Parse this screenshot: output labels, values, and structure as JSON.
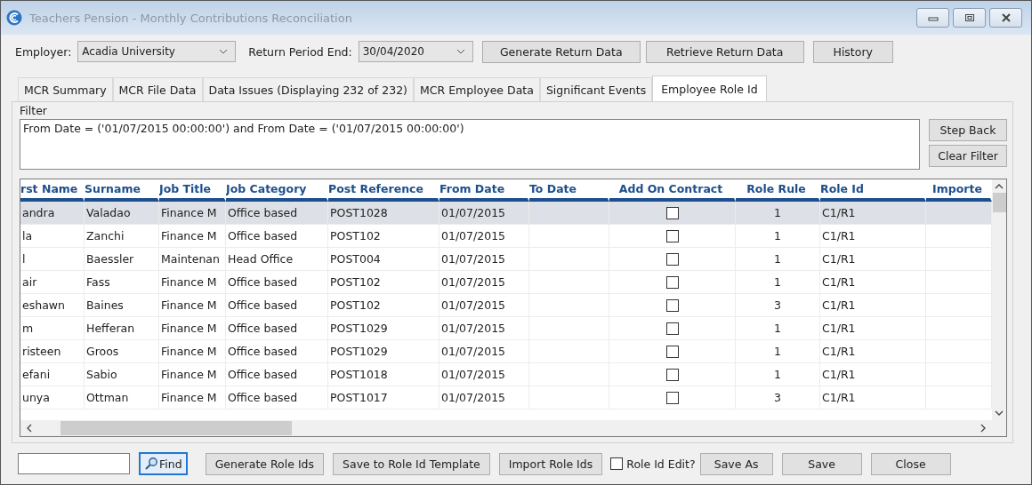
{
  "window": {
    "title": "Teachers Pension - Monthly Contributions Reconciliation"
  },
  "toolbar": {
    "employer_label": "Employer:",
    "employer_value": "Acadia University",
    "period_label": "Return Period End:",
    "period_value": "30/04/2020",
    "buttons": [
      "Generate Return Data",
      "Retrieve Return Data",
      "History"
    ]
  },
  "tabs": [
    {
      "label": "MCR Summary",
      "selected": false
    },
    {
      "label": "MCR File Data",
      "selected": false
    },
    {
      "label": "Data Issues (Displaying 232 of 232)",
      "selected": false
    },
    {
      "label": "MCR Employee Data",
      "selected": false
    },
    {
      "label": "Significant Events",
      "selected": false
    },
    {
      "label": "Employee Role Id",
      "selected": true
    }
  ],
  "filter": {
    "label": "Filter",
    "value": "From Date = ('01/07/2015 00:00:00') and From Date = ('01/07/2015 00:00:00')",
    "buttons": [
      "Step Back",
      "Clear Filter"
    ]
  },
  "table": {
    "columns": [
      "rst Name",
      "Surname",
      "Job Title",
      "Job Category",
      "Post Reference",
      "From Date",
      "To Date",
      "Add On Contract",
      "Role Rule",
      "Role Id",
      "Importe"
    ],
    "rows": [
      {
        "selected": true,
        "first_name": "andra",
        "surname": "Valadao",
        "job_title": "Finance M",
        "job_category": "Office based",
        "post_reference": "POST1028",
        "from_date": "01/07/2015",
        "add_on_contract": false,
        "role_rule": "1",
        "role_id": "C1/R1"
      },
      {
        "selected": false,
        "first_name": "la",
        "surname": "Zanchi",
        "job_title": "Finance M",
        "job_category": "Office based",
        "post_reference": "POST102",
        "from_date": "01/07/2015",
        "add_on_contract": false,
        "role_rule": "1",
        "role_id": "C1/R1"
      },
      {
        "selected": false,
        "first_name": "l",
        "surname": "Baessler",
        "job_title": "Maintenan",
        "job_category": "Head Office",
        "post_reference": "POST004",
        "from_date": "01/07/2015",
        "add_on_contract": false,
        "role_rule": "1",
        "role_id": "C1/R1"
      },
      {
        "selected": false,
        "first_name": "air",
        "surname": "Fass",
        "job_title": "Finance M",
        "job_category": "Office based",
        "post_reference": "POST102",
        "from_date": "01/07/2015",
        "add_on_contract": false,
        "role_rule": "1",
        "role_id": "C1/R1"
      },
      {
        "selected": false,
        "first_name": "eshawn",
        "surname": "Baines",
        "job_title": "Finance M",
        "job_category": "Office based",
        "post_reference": "POST102",
        "from_date": "01/07/2015",
        "add_on_contract": false,
        "role_rule": "3",
        "role_id": "C1/R1"
      },
      {
        "selected": false,
        "first_name": "m",
        "surname": "Hefferan",
        "job_title": "Finance M",
        "job_category": "Office based",
        "post_reference": "POST1029",
        "from_date": "01/07/2015",
        "add_on_contract": false,
        "role_rule": "1",
        "role_id": "C1/R1"
      },
      {
        "selected": false,
        "first_name": "risteen",
        "surname": "Groos",
        "job_title": "Finance M",
        "job_category": "Office based",
        "post_reference": "POST1029",
        "from_date": "01/07/2015",
        "add_on_contract": false,
        "role_rule": "1",
        "role_id": "C1/R1"
      },
      {
        "selected": false,
        "first_name": "efani",
        "surname": "Sabio",
        "job_title": "Finance M",
        "job_category": "Office based",
        "post_reference": "POST1018",
        "from_date": "01/07/2015",
        "add_on_contract": false,
        "role_rule": "1",
        "role_id": "C1/R1"
      },
      {
        "selected": false,
        "first_name": "unya",
        "surname": "Ottman",
        "job_title": "Finance M",
        "job_category": "Office based",
        "post_reference": "POST1017",
        "from_date": "01/07/2015",
        "add_on_contract": false,
        "role_rule": "3",
        "role_id": "C1/R1"
      }
    ]
  },
  "footer": {
    "find_button": "Find",
    "buttons": [
      "Generate Role Ids",
      "Save to Role Id Template",
      "Import Role Ids"
    ],
    "role_id_edit": {
      "label": "Role Id Edit?",
      "checked": false
    },
    "end_buttons": [
      "Save As",
      "Save",
      "Close"
    ]
  }
}
